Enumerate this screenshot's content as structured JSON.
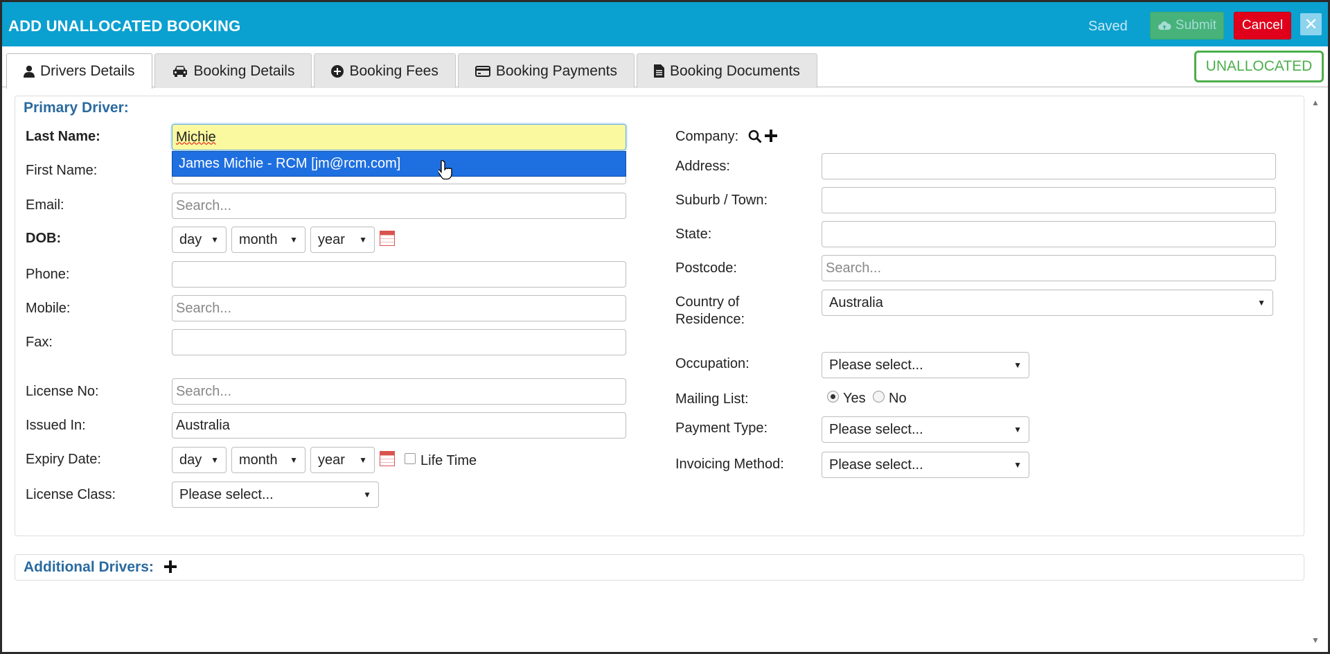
{
  "header": {
    "title": "ADD UNALLOCATED BOOKING",
    "saved": "Saved",
    "submit": "Submit",
    "cancel": "Cancel",
    "close": "✕"
  },
  "tabs": [
    {
      "label": "Drivers Details",
      "icon": "user-icon",
      "active": true
    },
    {
      "label": "Booking Details",
      "icon": "car-icon"
    },
    {
      "label": "Booking Fees",
      "icon": "plus-circle-icon"
    },
    {
      "label": "Booking Payments",
      "icon": "credit-card-icon"
    },
    {
      "label": "Booking Documents",
      "icon": "document-icon"
    }
  ],
  "status_badge": "UNALLOCATED",
  "primary_driver": {
    "title": "Primary Driver:",
    "labels": {
      "last_name": "Last Name:",
      "first_name": "First Name:",
      "email": "Email:",
      "dob": "DOB:",
      "phone": "Phone:",
      "mobile": "Mobile:",
      "fax": "Fax:",
      "license_no": "License No:",
      "issued_in": "Issued In:",
      "expiry_date": "Expiry Date:",
      "license_class": "License Class:"
    },
    "values": {
      "last_name": "Michie",
      "issued_in": "Australia"
    },
    "placeholders": {
      "search": "Search..."
    },
    "date_parts": {
      "day": "day",
      "month": "month",
      "year": "year"
    },
    "life_time": "Life Time",
    "please_select": "Please select...",
    "autocomplete": "James Michie - RCM [jm@rcm.com]"
  },
  "company": {
    "labels": {
      "company": "Company:",
      "address": "Address:",
      "suburb": "Suburb / Town:",
      "state": "State:",
      "postcode": "Postcode:",
      "country_l1": "Country of",
      "country_l2": "Residence:",
      "occupation": "Occupation:",
      "mailing_list": "Mailing List:",
      "payment_type": "Payment Type:",
      "invoicing_method": "Invoicing Method:"
    },
    "country_value": "Australia",
    "mailing_yes": "Yes",
    "mailing_no": "No",
    "mailing_selected": "Yes"
  },
  "additional_drivers": {
    "title": "Additional Drivers:"
  },
  "colors": {
    "header_bg": "#0aa0d0",
    "submit": "#5cb85c",
    "cancel": "#e0001b",
    "badge": "#4cae4c",
    "section_title": "#2a6aa0",
    "autocomplete": "#1e6fe0"
  }
}
